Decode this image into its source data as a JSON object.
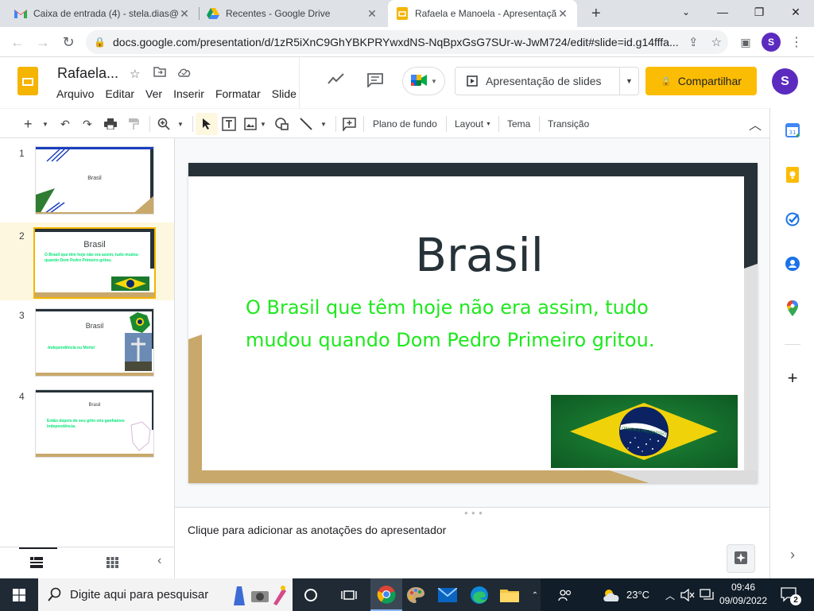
{
  "browser": {
    "tabs": [
      {
        "title": "Caixa de entrada (4) - stela.dias@",
        "favicon": "gmail-icon"
      },
      {
        "title": "Recentes - Google Drive",
        "favicon": "drive-icon"
      },
      {
        "title": "Rafaela e Manoela - Apresentaçã",
        "favicon": "slides-icon",
        "active": true
      }
    ],
    "new_tab": "+",
    "url": "docs.google.com/presentation/d/1zR5iXnC9GhYBKPRYwxdNS-NqBpxGsG7SUr-w-JwM724/edit#slide=id.g14fffa...",
    "profile_initial": "S"
  },
  "doc": {
    "title": "Rafaela...",
    "menu": [
      "Arquivo",
      "Editar",
      "Ver",
      "Inserir",
      "Formatar",
      "Slide"
    ],
    "present_label": "Apresentação de slides",
    "share_label": "Compartilhar",
    "profile_initial": "S"
  },
  "toolbar": {
    "background": "Plano de fundo",
    "layout": "Layout",
    "theme": "Tema",
    "transition": "Transição"
  },
  "slides": [
    {
      "num": "1",
      "title": "Brasil",
      "body": ""
    },
    {
      "num": "2",
      "title": "Brasil",
      "body": "O Brasil que têm hoje não era assim, tudo mudou quando Dom Pedro Primeiro gritou."
    },
    {
      "num": "3",
      "title": "Brasil",
      "body": "-Independência ou Morte!"
    },
    {
      "num": "4",
      "title": "Brasil",
      "body": "Então depois de seu grito nós ganhamos independência."
    }
  ],
  "current_slide": {
    "title": "Brasil",
    "body": "O Brasil que têm hoje não era assim, tudo mudou quando Dom Pedro Primeiro gritou.",
    "flag_motto": "ORDEM E PROGRESSO"
  },
  "notes": {
    "placeholder": "Clique para adicionar as anotações do apresentador"
  },
  "taskbar": {
    "search_placeholder": "Digite aqui para pesquisar",
    "temperature": "23°C",
    "time": "09:46",
    "date": "09/09/2022",
    "notifications": "2"
  },
  "colors": {
    "accent": "#fbbc04",
    "slide_title": "#263238",
    "slide_body": "#1ee81e",
    "theme_dark": "#263238",
    "theme_gold": "#c8a86b"
  }
}
